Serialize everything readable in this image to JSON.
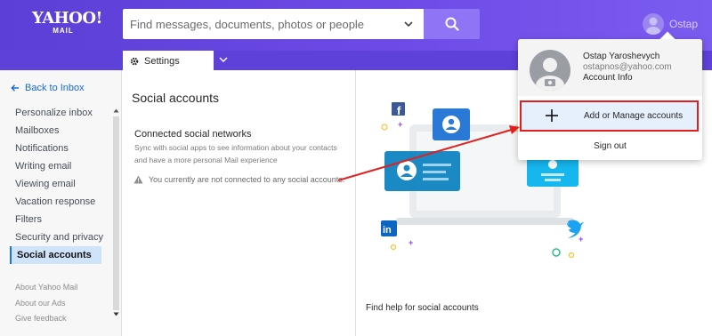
{
  "header": {
    "logo_main": "YAHOO!",
    "logo_sub": "MAIL",
    "search_placeholder": "Find messages, documents, photos or people",
    "user_name": "Ostap",
    "brand_color": "#6d4ae6"
  },
  "toolbar": {
    "settings_tab": "Settings"
  },
  "sidebar": {
    "back": "Back to Inbox",
    "items": [
      {
        "label": "Personalize inbox",
        "active": false
      },
      {
        "label": "Mailboxes",
        "active": false
      },
      {
        "label": "Notifications",
        "active": false
      },
      {
        "label": "Writing email",
        "active": false
      },
      {
        "label": "Viewing email",
        "active": false
      },
      {
        "label": "Vacation response",
        "active": false
      },
      {
        "label": "Filters",
        "active": false
      },
      {
        "label": "Security and privacy",
        "active": false
      },
      {
        "label": "Social accounts",
        "active": true
      }
    ],
    "footer": [
      "About Yahoo Mail",
      "About our Ads",
      "Give feedback"
    ]
  },
  "main": {
    "title": "Social accounts",
    "connected_title": "Connected social networks",
    "connected_desc": "Sync with social apps to see information about your contacts and have a more personal Mail experience",
    "warning": "You currently are not connected to any social accounts.",
    "help": "Find help for social accounts"
  },
  "account_menu": {
    "full_name": "Ostap Yaroshevych",
    "email": "ostapnos@yahoo.com",
    "account_info": "Account Info",
    "add_manage": "Add or Manage accounts",
    "sign_out": "Sign out"
  },
  "colors": {
    "highlight_box": "#e02020",
    "active_nav": "#cfe3fb",
    "link": "#196ad4"
  }
}
